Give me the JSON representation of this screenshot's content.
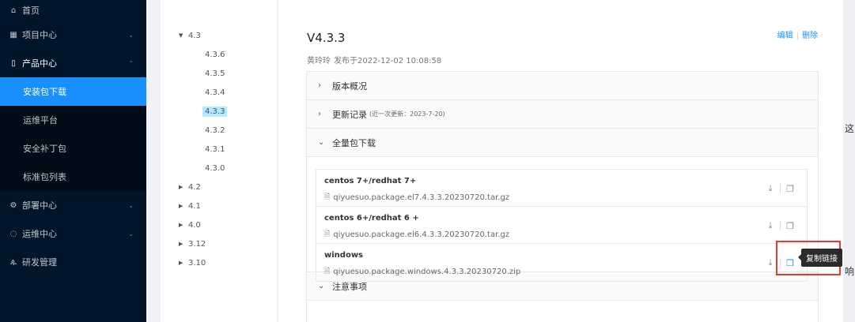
{
  "sidebar": {
    "home": "首页",
    "project_center": "项目中心",
    "product_center": "产品中心",
    "sub": [
      "安装包下载",
      "运维平台",
      "安全补丁包",
      "标准包列表"
    ],
    "deploy_center": "部署中心",
    "ops_center": "运维中心",
    "rd_mgmt": "研发管理"
  },
  "tree": {
    "v43": "4.3",
    "children": [
      "4.3.6",
      "4.3.5",
      "4.3.4",
      "4.3.3",
      "4.3.2",
      "4.3.1",
      "4.3.0"
    ],
    "others": [
      "4.2",
      "4.1",
      "4.0",
      "3.12",
      "3.10"
    ]
  },
  "main": {
    "title": "V4.3.3",
    "author": "黄玲玲",
    "published": "发布于2022-12-02 10:08:58",
    "edit": "编辑",
    "delete": "删除",
    "sections": {
      "overview": "版本概况",
      "changelog": "更新记录",
      "changelog_note": "(近一次更新：2023-7-20)",
      "full_download": "全量包下载",
      "notes": "注意事项"
    },
    "packages": [
      {
        "name": "centos 7+/redhat 7+",
        "file": "qiyuesuo.package.el7.4.3.3.20230720.tar.gz"
      },
      {
        "name": "centos 6+/redhat 6 +",
        "file": "qiyuesuo.package.el6.4.3.3.20230720.tar.gz"
      },
      {
        "name": "windows",
        "file": "qiyuesuo.package.windows.4.3.3.20230720.zip"
      }
    ],
    "tooltip": "复制链接"
  },
  "edge": {
    "t1": "这",
    "t2": "响"
  },
  "colors": {
    "accent": "#1890ff",
    "sidebar": "#001529",
    "highlight": "#e53935"
  }
}
